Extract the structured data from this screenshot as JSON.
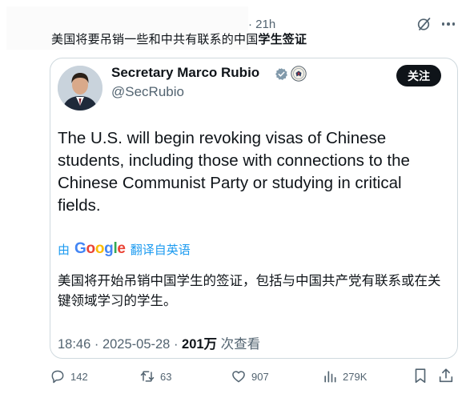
{
  "post": {
    "timestamp": "· 21h",
    "text_plain": "美国将要吊销一些和中共有联系的中国",
    "text_bold": "学生签证"
  },
  "quote": {
    "name": "Secretary Marco Rubio",
    "handle": "@SecRubio",
    "follow_label": "关注",
    "body": "The U.S. will begin revoking visas of Chinese students, including those with connections to the Chinese Communist Party or studying in critical fields.",
    "translate_prefix": "由",
    "translate_brand": "Google",
    "translate_suffix": "翻译自英语",
    "translated": "美国将开始吊销中国学生的签证，包括与中国共产党有联系或在关键领域学习的学生。",
    "meta_time": "18:46 · 2025-05-28 · ",
    "meta_views": "201万",
    "meta_views_suffix": " 次查看"
  },
  "actions": {
    "replies": "142",
    "reposts": "63",
    "likes": "907",
    "views": "279K"
  },
  "icons": {
    "grok": "grok-icon",
    "more": "more-icon",
    "verified": "verified-icon",
    "seal": "state-department-seal-icon",
    "reply": "reply-icon",
    "repost": "repost-icon",
    "like": "heart-icon",
    "views": "views-icon",
    "bookmark": "bookmark-icon",
    "share": "share-icon"
  },
  "colors": {
    "text": "#0f1419",
    "muted": "#536471",
    "border": "#cfd9de",
    "accent": "#1d9bf0",
    "follow_bg": "#0f1419"
  }
}
